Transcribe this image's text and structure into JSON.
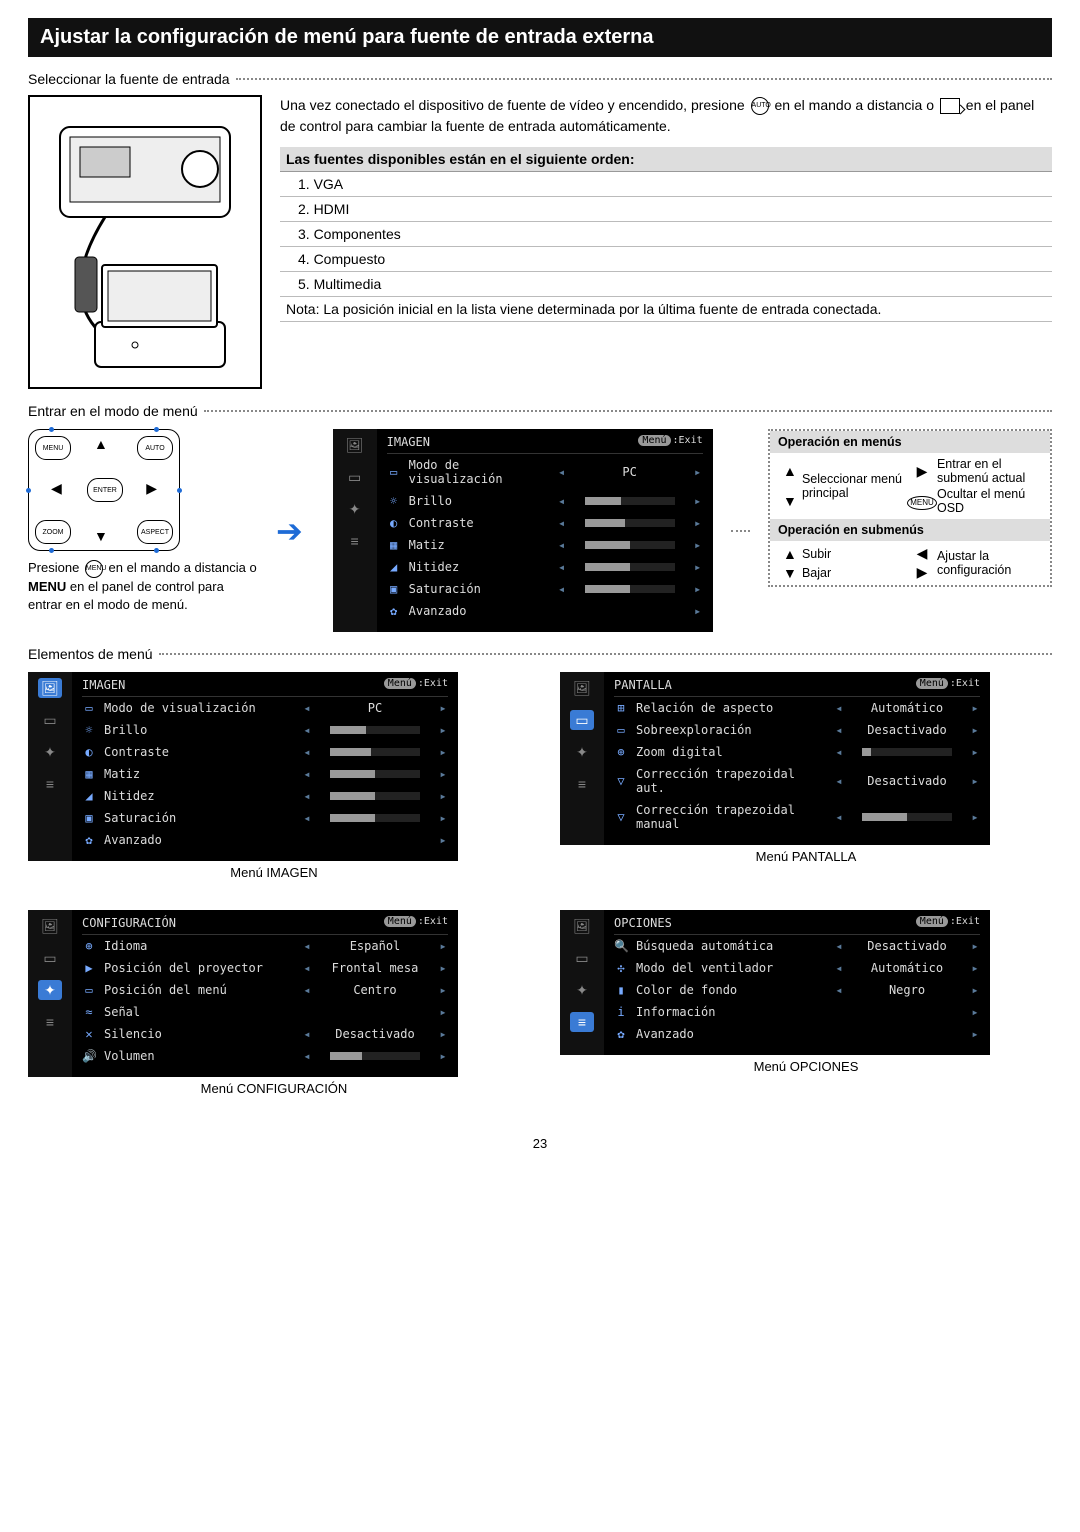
{
  "pageNumber": "23",
  "title": "Ajustar la configuración de menú para fuente de entrada externa",
  "section1": {
    "heading": "Seleccionar la fuente de entrada",
    "intro_a": "Una vez conectado el dispositivo de fuente de vídeo y encendido, presione ",
    "intro_b": " en el mando a distancia o ",
    "intro_c": " en el panel de control para cambiar la fuente de entrada automáticamente.",
    "iconAutoAlt": "AUTO",
    "tableHeader": "Las fuentes disponibles están en el siguiente orden:",
    "items": [
      "1.  VGA",
      "2.  HDMI",
      "3.  Componentes",
      "4.  Compuesto",
      "5.  Multimedia"
    ],
    "note": "Nota: La posición inicial en la lista viene determinada por la última fuente de entrada conectada."
  },
  "section2": {
    "heading": "Entrar en el modo de menú",
    "caption_a": "Presione ",
    "caption_b": " en el mando a distancia o ",
    "caption_c": "MENU",
    "caption_d": " en el panel de control para entrar en el modo de menú.",
    "remoteLabels": {
      "menu": "MENU",
      "auto": "AUTO",
      "enter": "ENTER",
      "zoom": "ZOOM",
      "aspect": "ASPECT"
    }
  },
  "osd_main": {
    "title": "IMAGEN",
    "exit": ":Exit",
    "menuTag": "Menú",
    "rows": [
      {
        "icon": "▭",
        "label": "Modo de visualización",
        "value": "PC",
        "type": "text"
      },
      {
        "icon": "☼",
        "label": "Brillo",
        "type": "slider",
        "fill": 40
      },
      {
        "icon": "◐",
        "label": "Contraste",
        "type": "slider",
        "fill": 45
      },
      {
        "icon": "▦",
        "label": "Matiz",
        "type": "slider",
        "fill": 50
      },
      {
        "icon": "◢",
        "label": "Nitidez",
        "type": "slider",
        "fill": 50
      },
      {
        "icon": "▣",
        "label": "Saturación",
        "type": "slider",
        "fill": 50
      },
      {
        "icon": "✿",
        "label": "Avanzado",
        "type": "none"
      }
    ]
  },
  "ops": {
    "h1": "Operación en menús",
    "r1a": "Seleccionar menú principal",
    "r1b": "Entrar en el submenú actual",
    "r1c": "Ocultar el menú OSD",
    "menuTag": "MENU",
    "h2": "Operación en submenús",
    "r2a": "Subir",
    "r2b": "Bajar",
    "r2c": "Ajustar la configuración"
  },
  "section3": {
    "heading": "Elementos de menú"
  },
  "menus": {
    "imagen": {
      "title": "IMAGEN",
      "caption": "Menú IMAGEN",
      "activeTab": 0,
      "rows": [
        {
          "icon": "▭",
          "label": "Modo de visualización",
          "value": "PC",
          "type": "text"
        },
        {
          "icon": "☼",
          "label": "Brillo",
          "type": "slider",
          "fill": 40
        },
        {
          "icon": "◐",
          "label": "Contraste",
          "type": "slider",
          "fill": 45
        },
        {
          "icon": "▦",
          "label": "Matiz",
          "type": "slider",
          "fill": 50
        },
        {
          "icon": "◢",
          "label": "Nitidez",
          "type": "slider",
          "fill": 50
        },
        {
          "icon": "▣",
          "label": "Saturación",
          "type": "slider",
          "fill": 50
        },
        {
          "icon": "✿",
          "label": "Avanzado",
          "type": "none"
        }
      ]
    },
    "pantalla": {
      "title": "PANTALLA",
      "caption": "Menú PANTALLA",
      "activeTab": 1,
      "rows": [
        {
          "icon": "⊞",
          "label": "Relación de aspecto",
          "value": "Automático",
          "type": "text"
        },
        {
          "icon": "▭",
          "label": "Sobreexploración",
          "value": "Desactivado",
          "type": "text"
        },
        {
          "icon": "⊕",
          "label": "Zoom digital",
          "type": "slider",
          "fill": 10
        },
        {
          "icon": "▽",
          "label": "Corrección trapezoidal aut.",
          "value": "Desactivado",
          "type": "text"
        },
        {
          "icon": "▽",
          "label": "Corrección trapezoidal manual",
          "type": "slider",
          "fill": 50
        }
      ]
    },
    "config": {
      "title": "CONFIGURACIÓN",
      "caption": "Menú CONFIGURACIÓN",
      "activeTab": 2,
      "rows": [
        {
          "icon": "⊕",
          "label": "Idioma",
          "value": "Español",
          "type": "text"
        },
        {
          "icon": "▶",
          "label": "Posición del proyector",
          "value": "Frontal mesa",
          "type": "text"
        },
        {
          "icon": "▭",
          "label": "Posición del menú",
          "value": "Centro",
          "type": "text"
        },
        {
          "icon": "≈",
          "label": "Señal",
          "type": "none"
        },
        {
          "icon": "✕",
          "label": "Silencio",
          "value": "Desactivado",
          "type": "text"
        },
        {
          "icon": "🔊",
          "label": "Volumen",
          "type": "slider",
          "fill": 35
        }
      ]
    },
    "opciones": {
      "title": "OPCIONES",
      "caption": "Menú OPCIONES",
      "activeTab": 3,
      "rows": [
        {
          "icon": "🔍",
          "label": "Búsqueda automática",
          "value": "Desactivado",
          "type": "text"
        },
        {
          "icon": "✣",
          "label": "Modo del ventilador",
          "value": "Automático",
          "type": "text"
        },
        {
          "icon": "▮",
          "label": "Color de fondo",
          "value": "Negro",
          "type": "text"
        },
        {
          "icon": "i",
          "label": "Información",
          "type": "none"
        },
        {
          "icon": "✿",
          "label": "Avanzado",
          "type": "none"
        }
      ]
    }
  }
}
